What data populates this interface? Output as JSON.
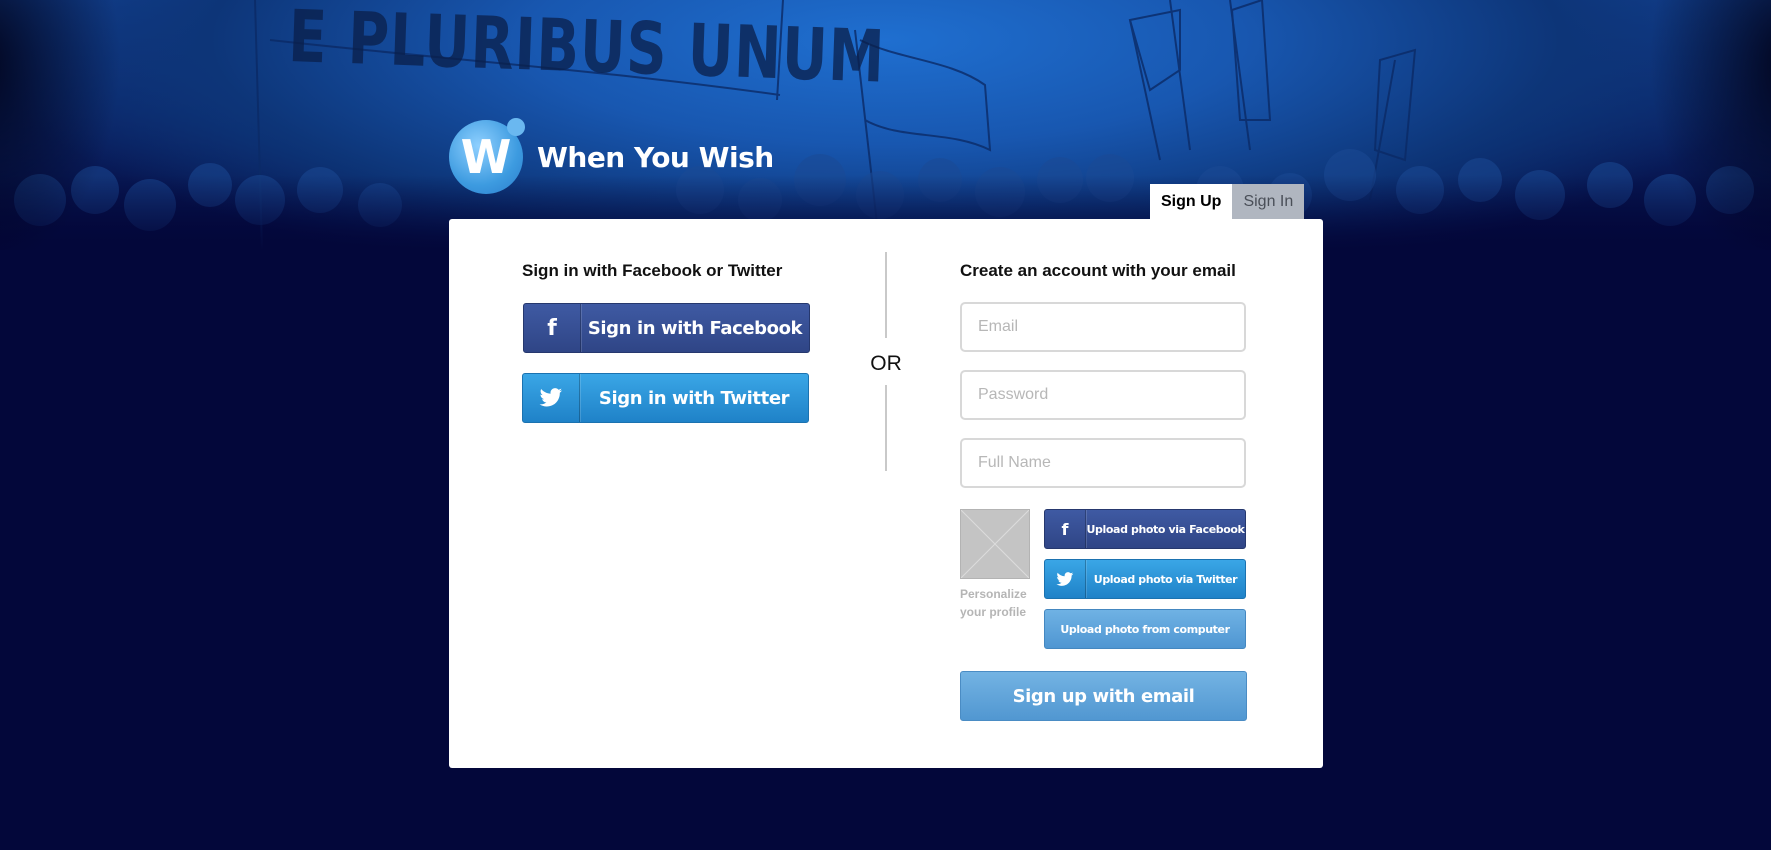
{
  "hero": {
    "banner_text": "E PLURIBUS UNUM"
  },
  "brand": {
    "logo_letter": "W",
    "name": "When You Wish"
  },
  "tabs": [
    {
      "label": "Sign Up",
      "active": true
    },
    {
      "label": "Sign In",
      "active": false
    }
  ],
  "social": {
    "heading": "Sign in with Facebook or Twitter",
    "facebook_label": "Sign in with Facebook",
    "facebook_icon": "f",
    "twitter_label": "Sign in with Twitter",
    "or_text": "OR"
  },
  "email_signup": {
    "heading": "Create an account with your email",
    "email_placeholder": "Email",
    "password_placeholder": "Password",
    "fullname_placeholder": "Full Name",
    "avatar_caption": "Personalize your profile",
    "upload_facebook": "Upload photo via Facebook",
    "upload_twitter": "Upload photo via Twitter",
    "upload_computer": "Upload photo from computer",
    "submit_label": "Sign up with email"
  },
  "colors": {
    "background": "#03073a",
    "facebook": "#2f4586",
    "twitter": "#1f82c8",
    "accent_light_blue": "#5f9fd6"
  }
}
